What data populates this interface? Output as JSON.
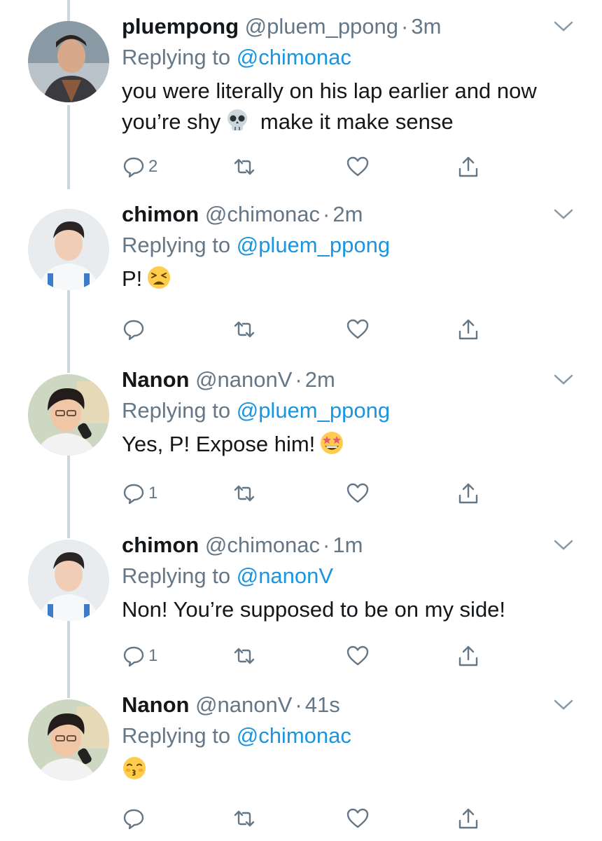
{
  "colors": {
    "text": "#14171a",
    "secondary": "#657786",
    "link": "#1b95e0",
    "thread_line": "#ccd6dd"
  },
  "tweets": [
    {
      "name": "pluempong",
      "handle": "@pluem_ppong",
      "dot": "·",
      "time": "3m",
      "replying_prefix": "Replying to",
      "replying_to": "@chimonac",
      "text_before": "you were literally on his lap earlier and now you’re shy",
      "emoji": "skull-emoji",
      "text_after": "make it make sense",
      "reply_count": "2",
      "avatar": "avatar-pluempong"
    },
    {
      "name": "chimon",
      "handle": "@chimonac",
      "dot": "·",
      "time": "2m",
      "replying_prefix": "Replying to",
      "replying_to": "@pluem_ppong",
      "text_before": "P!",
      "emoji": "tired-face-emoji",
      "text_after": "",
      "reply_count": "",
      "avatar": "avatar-chimon"
    },
    {
      "name": "Nanon",
      "handle": "@nanonV",
      "dot": "·",
      "time": "2m",
      "replying_prefix": "Replying to",
      "replying_to": "@pluem_ppong",
      "text_before": "Yes, P! Expose him!",
      "emoji": "star-struck-emoji",
      "text_after": "",
      "reply_count": "1",
      "avatar": "avatar-nanon"
    },
    {
      "name": "chimon",
      "handle": "@chimonac",
      "dot": "·",
      "time": "1m",
      "replying_prefix": "Replying to",
      "replying_to": "@nanonV",
      "text_before": "Non! You’re supposed to be on my side!",
      "emoji": "",
      "text_after": "",
      "reply_count": "1",
      "avatar": "avatar-chimon"
    },
    {
      "name": "Nanon",
      "handle": "@nanonV",
      "dot": "·",
      "time": "41s",
      "replying_prefix": "Replying to",
      "replying_to": "@chimonac",
      "text_before": "",
      "emoji": "kissing-face-emoji",
      "text_after": "",
      "reply_count": "",
      "avatar": "avatar-nanon"
    }
  ],
  "icons": {
    "reply": "reply-icon",
    "retweet": "retweet-icon",
    "like": "like-icon",
    "share": "share-icon",
    "more": "chevron-down-icon"
  }
}
